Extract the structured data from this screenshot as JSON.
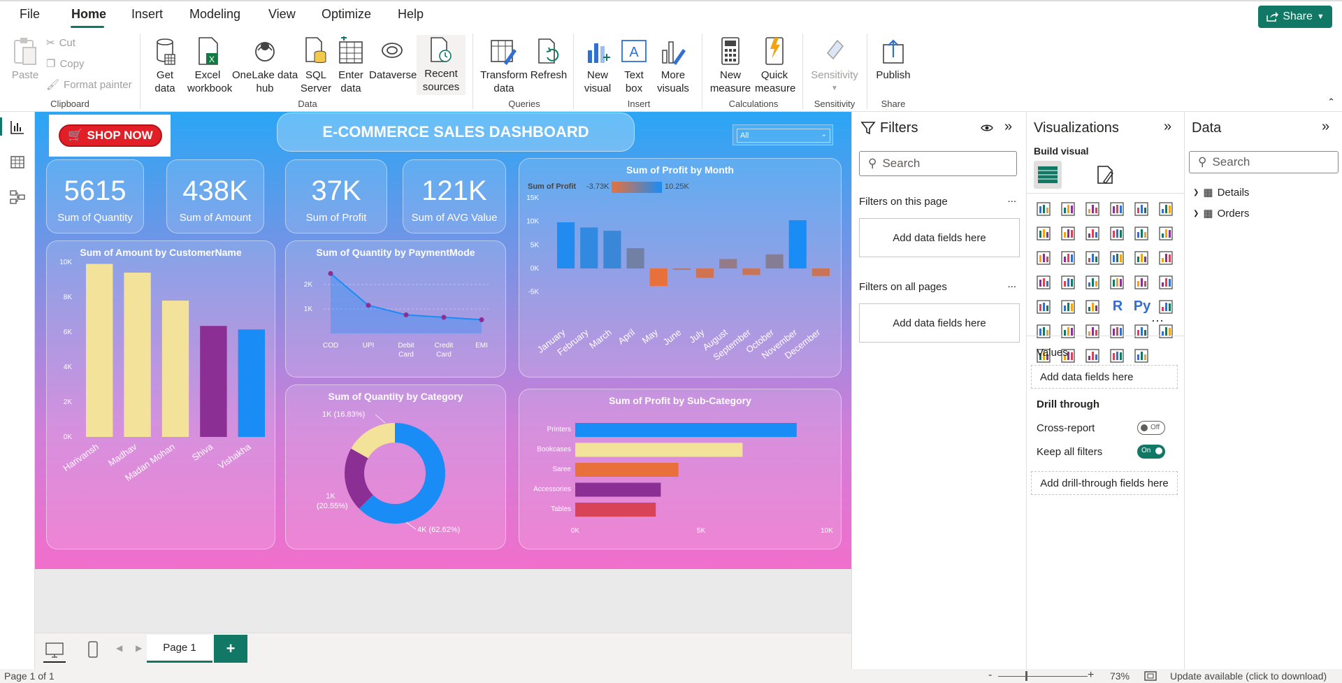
{
  "menu": {
    "tabs": [
      "File",
      "Home",
      "Insert",
      "Modeling",
      "View",
      "Optimize",
      "Help"
    ],
    "share_label": "Share"
  },
  "ribbon": {
    "clipboard": {
      "paste": "Paste",
      "cut": "Cut",
      "copy": "Copy",
      "format_painter": "Format painter",
      "group": "Clipboard"
    },
    "data": {
      "get_data": "Get\ndata",
      "excel": "Excel\nworkbook",
      "onelake": "OneLake data\nhub",
      "sql": "SQL\nServer",
      "enter": "Enter\ndata",
      "dataverse": "Dataverse",
      "recent": "Recent\nsources",
      "group": "Data"
    },
    "queries": {
      "transform": "Transform\ndata",
      "refresh": "Refresh",
      "group": "Queries"
    },
    "insert": {
      "new_visual": "New\nvisual",
      "text_box": "Text\nbox",
      "more_visuals": "More\nvisuals",
      "group": "Insert"
    },
    "calculations": {
      "new_measure": "New\nmeasure",
      "quick_measure": "Quick\nmeasure",
      "group": "Calculations"
    },
    "sensitivity": {
      "label": "Sensitivity",
      "group": "Sensitivity"
    },
    "share": {
      "publish": "Publish",
      "group": "Share"
    }
  },
  "report": {
    "shop_now": "SHOP NOW",
    "title": "E-COMMERCE SALES DASHBOARD",
    "slicer_value": "All",
    "kpis": [
      {
        "value": "5615",
        "label": "Sum of Quantity"
      },
      {
        "value": "438K",
        "label": "Sum of Amount"
      },
      {
        "value": "37K",
        "label": "Sum of Profit"
      },
      {
        "value": "121K",
        "label": "Sum of AVG Value"
      }
    ],
    "charts": {
      "amount_by_customer": {
        "title": "Sum of Amount by CustomerName"
      },
      "qty_by_payment": {
        "title": "Sum of Quantity by PaymentMode"
      },
      "profit_by_month": {
        "title": "Sum of Profit by Month",
        "legend_label": "Sum of Profit",
        "legend_min": "-3.73K",
        "legend_max": "10.25K"
      },
      "qty_by_category": {
        "title": "Sum of Quantity by Category"
      },
      "profit_by_subcat": {
        "title": "Sum of Profit by Sub-Category"
      }
    }
  },
  "chart_data": [
    {
      "type": "bar",
      "title": "Sum of Amount by CustomerName",
      "categories": [
        "Harivansh",
        "Madhav",
        "Madan Mohan",
        "Shiva",
        "Vishakha"
      ],
      "values": [
        9900,
        9400,
        7800,
        6350,
        6150
      ],
      "yticks": [
        "0K",
        "2K",
        "4K",
        "6K",
        "8K",
        "10K"
      ],
      "ylim": [
        0,
        10000
      ],
      "colors": [
        "#f2e29a",
        "#f2e29a",
        "#f2e29a",
        "#8b2f94",
        "#1a8cf5"
      ]
    },
    {
      "type": "line",
      "title": "Sum of Quantity by PaymentMode",
      "categories": [
        "COD",
        "UPI",
        "Debit Card",
        "Credit Card",
        "EMI"
      ],
      "values": [
        2450,
        1150,
        760,
        660,
        560
      ],
      "yticks": [
        "1K",
        "2K"
      ],
      "ylim": [
        0,
        2800
      ]
    },
    {
      "type": "bar",
      "title": "Sum of Profit by Month",
      "categories": [
        "January",
        "February",
        "March",
        "April",
        "May",
        "June",
        "July",
        "August",
        "September",
        "October",
        "November",
        "December"
      ],
      "values": [
        9800,
        8700,
        8000,
        4300,
        -3730,
        -300,
        -2000,
        2000,
        -1400,
        3000,
        10250,
        -1600
      ],
      "yticks": [
        "-5K",
        "0K",
        "5K",
        "10K",
        "15K"
      ],
      "ylim": [
        -5500,
        15000
      ]
    },
    {
      "type": "pie",
      "title": "Sum of Quantity by Category",
      "labels": [
        "1K (16.83%)",
        "1K\n(20.55%)",
        "4K (62.62%)"
      ],
      "values": [
        16.83,
        20.55,
        62.62
      ],
      "colors": [
        "#f2e29a",
        "#8b2f94",
        "#1a8cf5"
      ]
    },
    {
      "type": "bar",
      "title": "Sum of Profit by Sub-Category",
      "categories": [
        "Printers",
        "Bookcases",
        "Saree",
        "Accessories",
        "Tables"
      ],
      "values": [
        8800,
        6650,
        4100,
        3400,
        3200
      ],
      "xticks": [
        "0K",
        "5K",
        "10K"
      ],
      "xlim": [
        0,
        10000
      ],
      "colors": [
        "#1a8cf5",
        "#f2e29a",
        "#e8703a",
        "#8b2f94",
        "#d94358"
      ]
    }
  ],
  "pagebar": {
    "page_label": "Page 1",
    "add": "+"
  },
  "status": {
    "page_info": "Page 1 of 1",
    "zoom": "73%",
    "update": "Update available (click to download)",
    "minus": "-",
    "plus": "+"
  },
  "filters": {
    "title": "Filters",
    "search": "Search",
    "on_page": "Filters on this page",
    "on_all": "Filters on all pages",
    "add_fields": "Add data fields here",
    "more": "..."
  },
  "visualizations": {
    "title": "Visualizations",
    "build": "Build visual",
    "values": "Values",
    "add_fields": "Add data fields here",
    "drill": "Drill through",
    "cross": "Cross-report",
    "cross_state": "Off",
    "keep": "Keep all filters",
    "keep_state": "On",
    "add_drill": "Add drill-through fields here",
    "more": "···",
    "r": "R",
    "py": "Py"
  },
  "data_pane": {
    "title": "Data",
    "search": "Search",
    "tables": [
      "Details",
      "Orders"
    ]
  }
}
